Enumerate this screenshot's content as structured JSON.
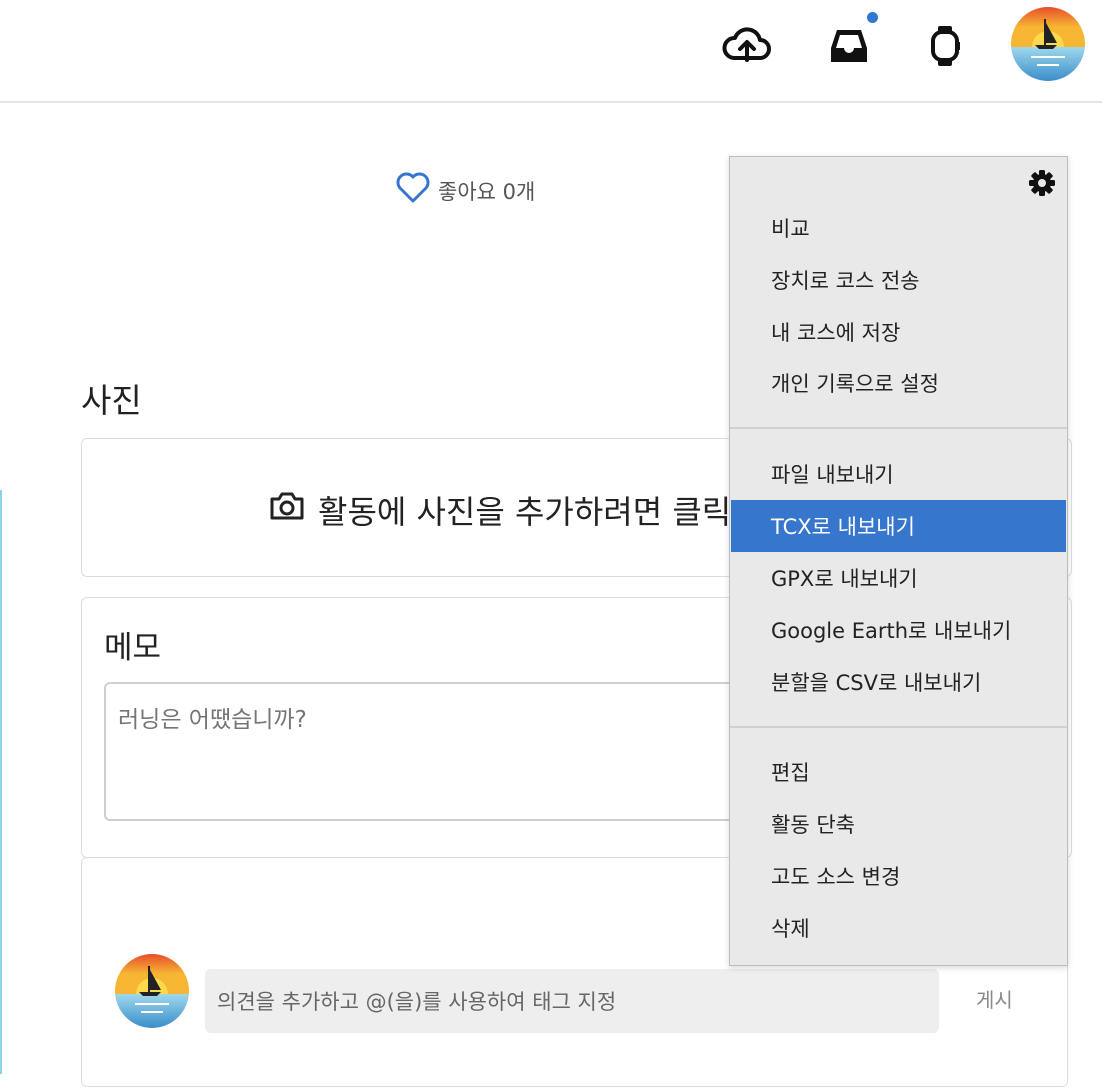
{
  "header": {
    "icons": [
      "upload-cloud-icon",
      "inbox-icon",
      "watch-icon"
    ],
    "notification_dot_color": "#3178d4"
  },
  "likes": {
    "label": "좋아요 0개"
  },
  "photos": {
    "title": "사진",
    "cta": "활동에 사진을 추가하려면 클릭"
  },
  "memo": {
    "title": "메모",
    "placeholder": "러닝은 어땠습니까?"
  },
  "comment": {
    "placeholder": "의견을 추가하고 @(을)를 사용하여 태그 지정",
    "post_label": "게시"
  },
  "menu": {
    "group1": [
      "비교",
      "장치로 코스 전송",
      "내 코스에 저장",
      "개인 기록으로 설정"
    ],
    "group2": [
      "파일 내보내기",
      "TCX로 내보내기",
      "GPX로 내보내기",
      "Google Earth로 내보내기",
      "분할을 CSV로 내보내기"
    ],
    "group3": [
      "편집",
      "활동 단축",
      "고도 소스 변경",
      "삭제"
    ],
    "active_item": "TCX로 내보내기",
    "active_color": "#3676cd"
  }
}
